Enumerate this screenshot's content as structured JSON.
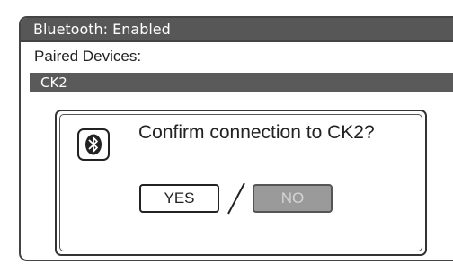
{
  "title_bar": {
    "text": "Bluetooth: Enabled"
  },
  "list": {
    "header": "Paired Devices:",
    "devices": [
      {
        "name": "CK2",
        "selected": true
      }
    ]
  },
  "dialog": {
    "icon": "bluetooth-icon",
    "message": "Confirm connection to CK2?",
    "yes_label": "YES",
    "no_label": "NO",
    "selected_option": "YES"
  },
  "colors": {
    "title_bar_bg": "#575757",
    "selected_row_bg": "#5a5a5a",
    "disabled_button_bg": "#9a9a9a",
    "text": "#222222"
  }
}
